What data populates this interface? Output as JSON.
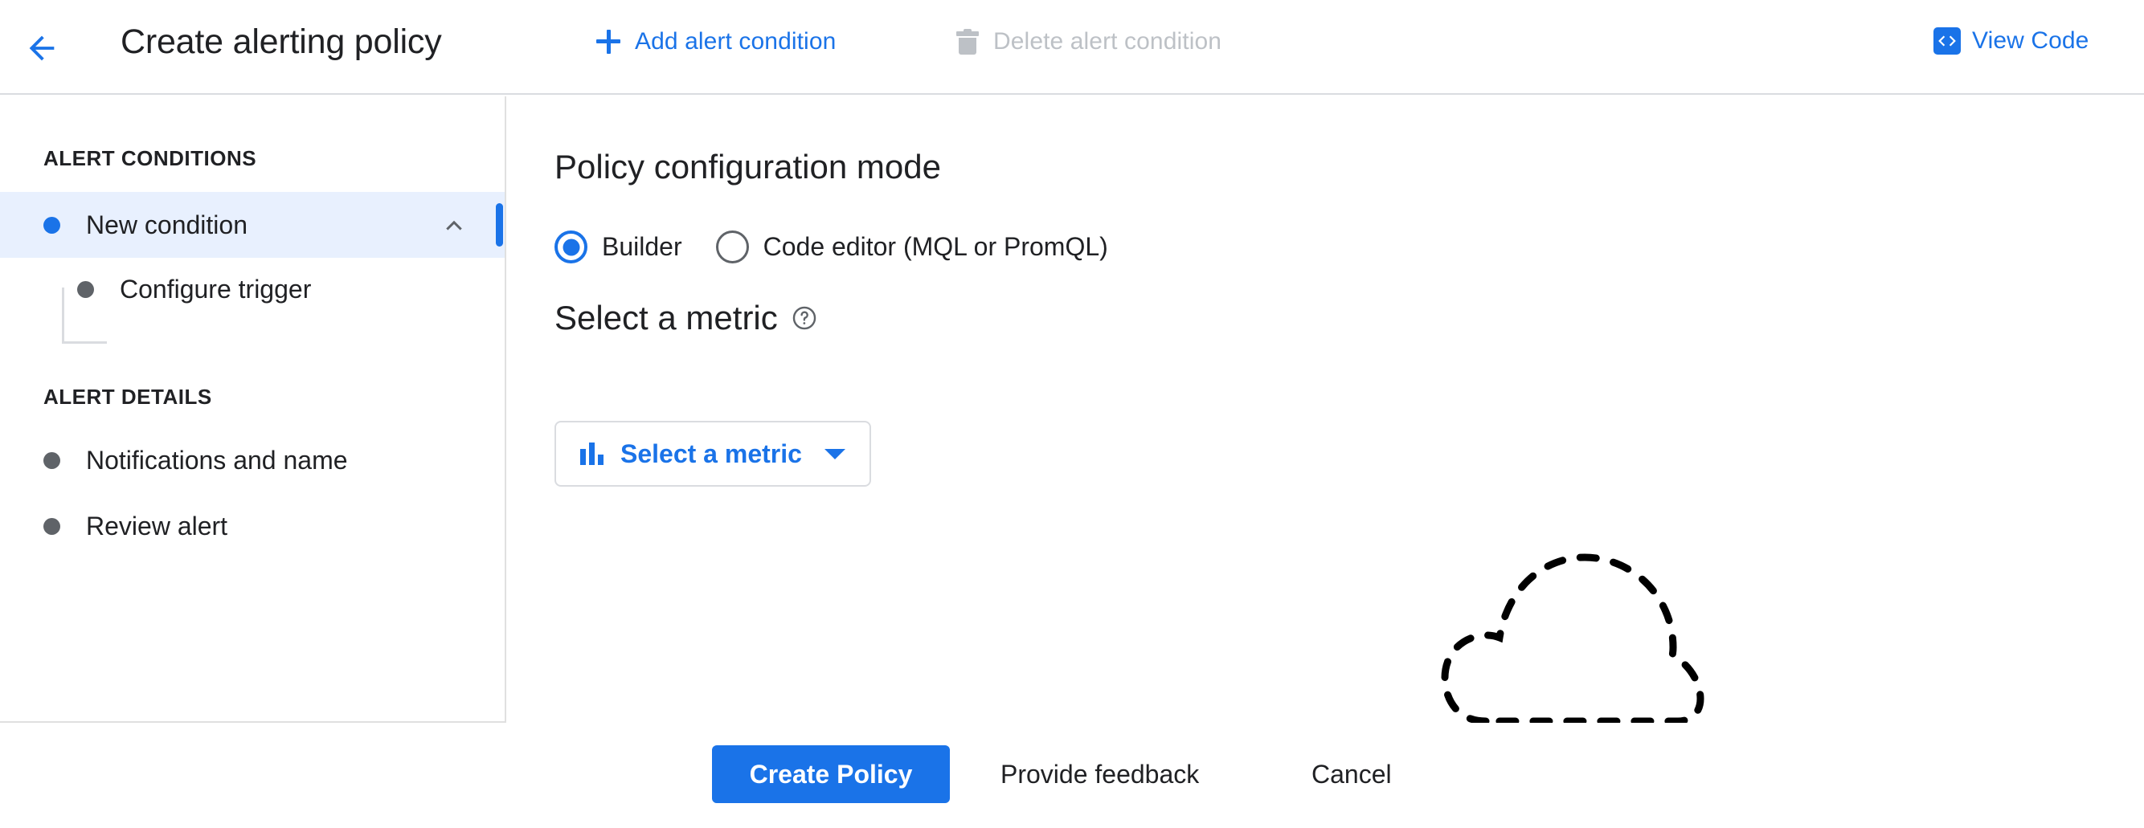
{
  "header": {
    "back_icon": "arrow-back-icon",
    "title": "Create alerting policy",
    "add_condition": {
      "label": "Add alert condition",
      "icon": "plus-icon",
      "enabled": true,
      "color": "#1a73e8"
    },
    "delete_condition": {
      "label": "Delete alert condition",
      "icon": "trash-icon",
      "enabled": false,
      "color": "#bdc1c6"
    },
    "view_code": {
      "label": "View Code",
      "icon": "code-brackets-icon",
      "color": "#1a73e8"
    }
  },
  "sidebar": {
    "sections": [
      {
        "label": "ALERT CONDITIONS",
        "items": [
          {
            "label": "New condition",
            "bullet": "blue",
            "selected": true,
            "expanded": true,
            "chevron_icon": "chevron-up-icon"
          },
          {
            "label": "Configure trigger",
            "bullet": "grey",
            "selected": false,
            "child": true
          }
        ]
      },
      {
        "label": "ALERT DETAILS",
        "items": [
          {
            "label": "Notifications and name",
            "bullet": "grey",
            "selected": false
          },
          {
            "label": "Review alert",
            "bullet": "grey",
            "selected": false
          }
        ]
      }
    ]
  },
  "main": {
    "mode_heading": "Policy configuration mode",
    "mode_options": [
      {
        "label": "Builder",
        "selected": true
      },
      {
        "label": "Code editor (MQL or PromQL)",
        "selected": false
      }
    ],
    "metric_heading": "Select a metric",
    "metric_help_icon": "help-circle-icon",
    "metric_button": {
      "label": "Select a metric",
      "icon": "bar-chart-icon",
      "caret_icon": "caret-down-icon"
    },
    "illustration": "dashed-cloud-icon"
  },
  "footer": {
    "primary": "Create Policy",
    "feedback": "Provide feedback",
    "cancel": "Cancel"
  },
  "colors": {
    "accent": "#1a73e8",
    "selected_row_bg": "#e8f0fe",
    "disabled_text": "#bdc1c6",
    "text": "#202124",
    "border": "#dadce0"
  }
}
